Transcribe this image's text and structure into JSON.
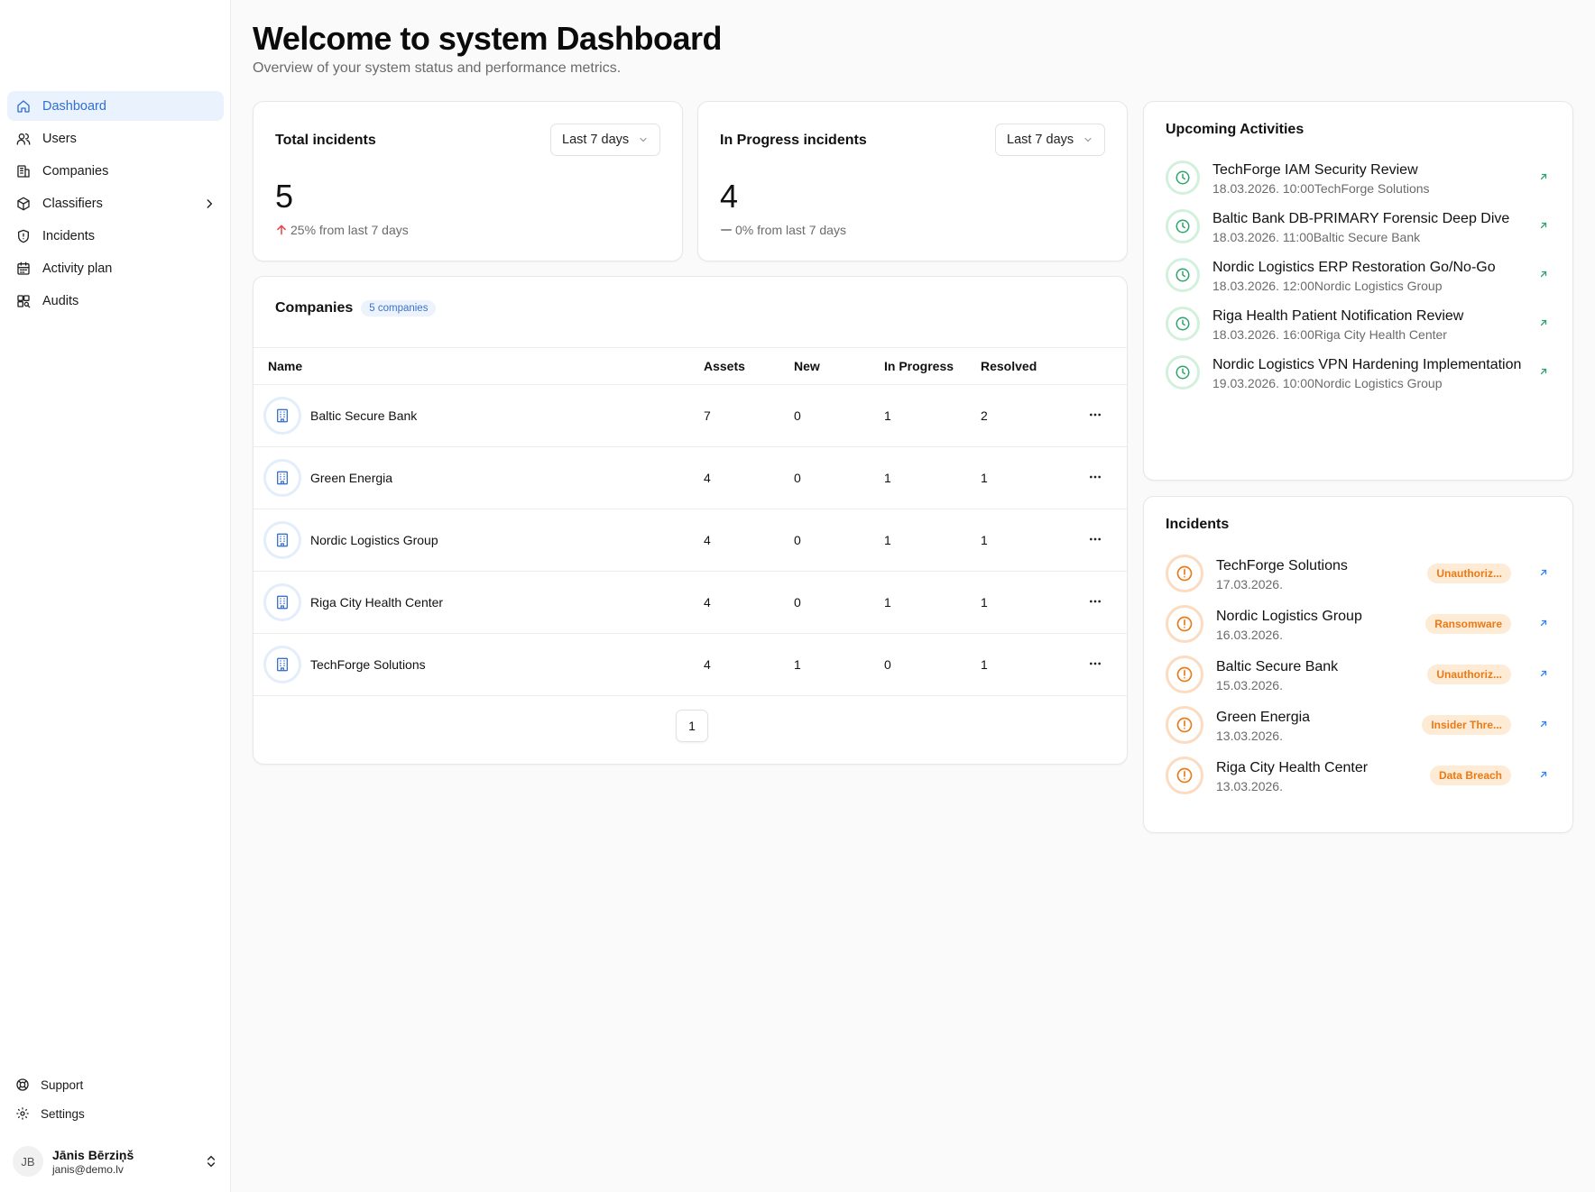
{
  "sidebar": {
    "items": [
      {
        "label": "Dashboard",
        "icon": "home-icon",
        "active": true
      },
      {
        "label": "Users",
        "icon": "users-icon"
      },
      {
        "label": "Companies",
        "icon": "building-icon"
      },
      {
        "label": "Classifiers",
        "icon": "box-icon",
        "has_children": true
      },
      {
        "label": "Incidents",
        "icon": "shield-icon"
      },
      {
        "label": "Activity plan",
        "icon": "calendar-icon"
      },
      {
        "label": "Audits",
        "icon": "audit-icon"
      }
    ],
    "support_label": "Support",
    "settings_label": "Settings",
    "user": {
      "initials": "JB",
      "name": "Jānis Bērziņš",
      "email": "janis@demo.lv"
    }
  },
  "header": {
    "title": "Welcome to system Dashboard",
    "subtitle": "Overview of your system status and performance metrics."
  },
  "stats": [
    {
      "title": "Total incidents",
      "range": "Last 7 days",
      "value": "5",
      "change": "25% from last 7 days",
      "trend": "up"
    },
    {
      "title": "In Progress incidents",
      "range": "Last 7 days",
      "value": "4",
      "change": "0% from last 7 days",
      "trend": "flat"
    }
  ],
  "companies": {
    "title": "Companies",
    "count_badge": "5 companies",
    "columns": [
      "Name",
      "Assets",
      "New",
      "In Progress",
      "Resolved"
    ],
    "rows": [
      {
        "name": "Baltic Secure Bank",
        "assets": "7",
        "new": "0",
        "in_progress": "1",
        "resolved": "2"
      },
      {
        "name": "Green Energia",
        "assets": "4",
        "new": "0",
        "in_progress": "1",
        "resolved": "1"
      },
      {
        "name": "Nordic Logistics Group",
        "assets": "4",
        "new": "0",
        "in_progress": "1",
        "resolved": "1"
      },
      {
        "name": "Riga City Health Center",
        "assets": "4",
        "new": "0",
        "in_progress": "1",
        "resolved": "1"
      },
      {
        "name": "TechForge Solutions",
        "assets": "4",
        "new": "1",
        "in_progress": "0",
        "resolved": "1"
      }
    ],
    "page": "1"
  },
  "activities": {
    "title": "Upcoming Activities",
    "items": [
      {
        "name": "TechForge IAM Security Review",
        "datetime": "18.03.2026. 10:00",
        "company": "TechForge Solutions"
      },
      {
        "name": "Baltic Bank DB-PRIMARY Forensic Deep Dive",
        "datetime": "18.03.2026. 11:00",
        "company": "Baltic Secure Bank"
      },
      {
        "name": "Nordic Logistics ERP Restoration Go/No-Go",
        "datetime": "18.03.2026. 12:00",
        "company": "Nordic Logistics Group"
      },
      {
        "name": "Riga Health Patient Notification Review",
        "datetime": "18.03.2026. 16:00",
        "company": "Riga City Health Center"
      },
      {
        "name": "Nordic Logistics VPN Hardening Implementation",
        "datetime": "19.03.2026. 10:00",
        "company": "Nordic Logistics Group"
      }
    ]
  },
  "incidents": {
    "title": "Incidents",
    "items": [
      {
        "company": "TechForge Solutions",
        "date": "17.03.2026.",
        "type": "Unauthoriz..."
      },
      {
        "company": "Nordic Logistics Group",
        "date": "16.03.2026.",
        "type": "Ransomware"
      },
      {
        "company": "Baltic Secure Bank",
        "date": "15.03.2026.",
        "type": "Unauthoriz..."
      },
      {
        "company": "Green Energia",
        "date": "13.03.2026.",
        "type": "Insider Thre..."
      },
      {
        "company": "Riga City Health Center",
        "date": "13.03.2026.",
        "type": "Data Breach"
      }
    ]
  },
  "colors": {
    "accent": "#2f6fd3",
    "active_bg": "#eaf2fd",
    "trend_up": "#e5484d",
    "activity_green": "#30a46c",
    "incident_orange": "#ea7a16",
    "arrow_blue": "#3b82f6"
  }
}
